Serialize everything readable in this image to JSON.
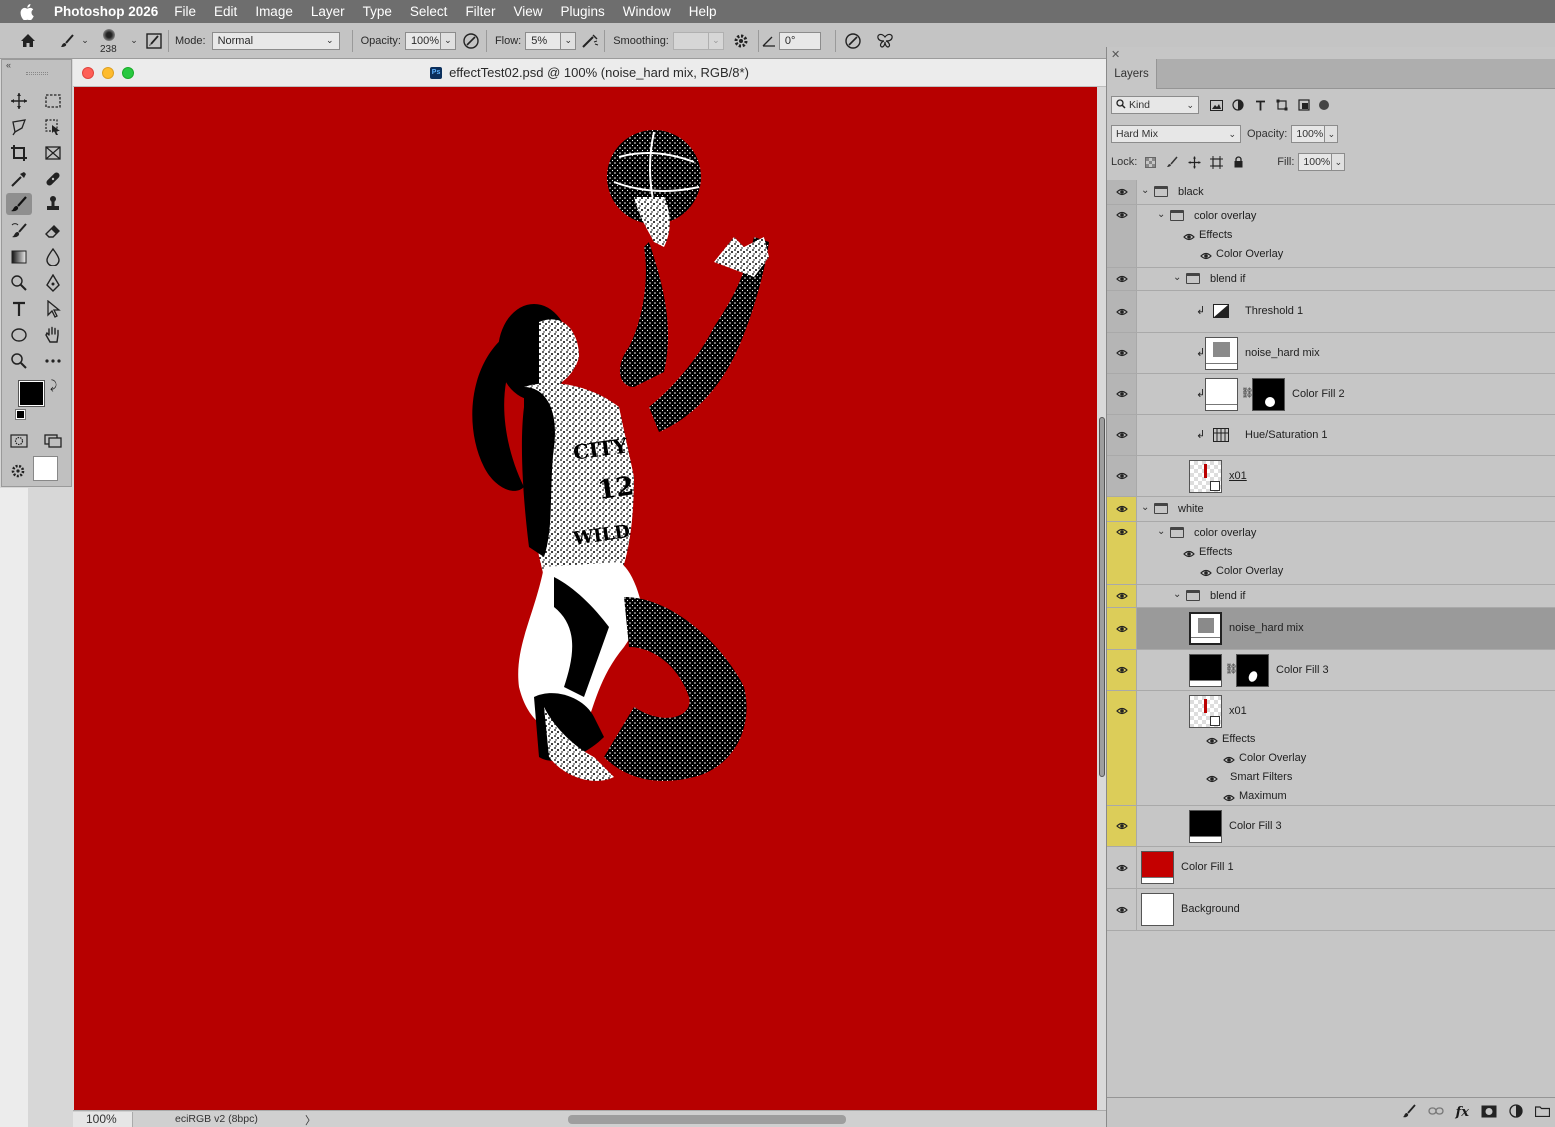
{
  "menubar": {
    "app_name": "Photoshop 2026",
    "items": [
      "File",
      "Edit",
      "Image",
      "Layer",
      "Type",
      "Select",
      "Filter",
      "View",
      "Plugins",
      "Window",
      "Help"
    ]
  },
  "options": {
    "brush_size": "238",
    "mode_label": "Mode:",
    "mode_value": "Normal",
    "opacity_label": "Opacity:",
    "opacity_value": "100%",
    "flow_label": "Flow:",
    "flow_value": "5%",
    "smoothing_label": "Smoothing:",
    "smoothing_value": "",
    "angle_value": "0°"
  },
  "document": {
    "title": "effectTest02.psd @ 100% (noise_hard mix, RGB/8*)",
    "zoom": "100%",
    "color_profile": "eciRGB v2 (8bpc)",
    "canvas_color": "#b70000",
    "arrow": "〉"
  },
  "layers_panel": {
    "tab": "Layers",
    "filter_kind": "Kind",
    "blend_mode": "Hard Mix",
    "opacity_label": "Opacity:",
    "opacity_value": "100%",
    "lock_label": "Lock:",
    "fill_label": "Fill:",
    "fill_value": "100%",
    "rows": [
      {
        "label": "black"
      },
      {
        "label": "color overlay"
      },
      {
        "label": "Effects"
      },
      {
        "label": "Color Overlay"
      },
      {
        "label": "blend if"
      },
      {
        "label": "Threshold 1"
      },
      {
        "label": "noise_hard mix"
      },
      {
        "label": "Color Fill 2"
      },
      {
        "label": "Hue/Saturation 1"
      },
      {
        "label": "x01"
      },
      {
        "label": "white"
      },
      {
        "label": "color overlay"
      },
      {
        "label": "Effects"
      },
      {
        "label": "Color Overlay"
      },
      {
        "label": "blend if"
      },
      {
        "label": "noise_hard mix"
      },
      {
        "label": "Color Fill 3"
      },
      {
        "label": "x01"
      },
      {
        "label": "Effects"
      },
      {
        "label": "Color Overlay"
      },
      {
        "label": "Smart Filters"
      },
      {
        "label": "Maximum"
      },
      {
        "label": "Color Fill 3"
      },
      {
        "label": "Color Fill 1"
      },
      {
        "label": "Background"
      }
    ],
    "colors": {
      "yellow_tag": "#dccd59",
      "fill1": "#c40000"
    }
  }
}
